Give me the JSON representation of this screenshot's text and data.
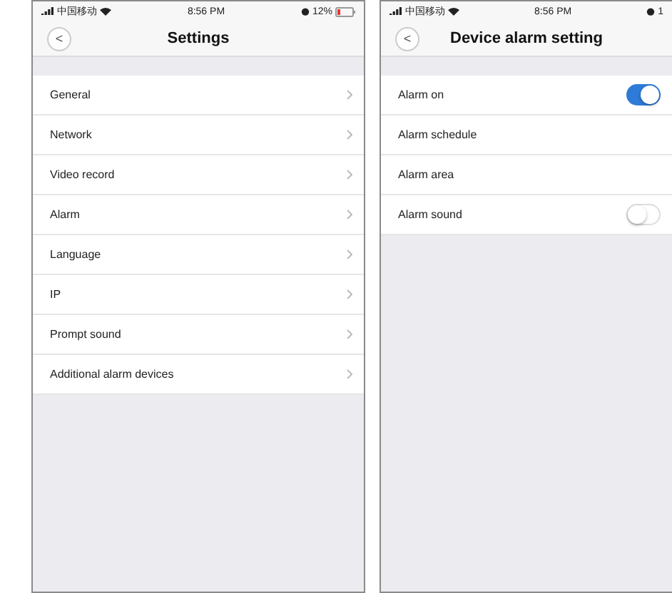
{
  "screens": [
    {
      "status": {
        "carrier": "中国移动",
        "time": "8:56 PM",
        "battery": "12%"
      },
      "title": "Settings",
      "back": "<",
      "rows": [
        {
          "kind": "link",
          "label": "General"
        },
        {
          "kind": "link",
          "label": "Network"
        },
        {
          "kind": "link",
          "label": "Video record"
        },
        {
          "kind": "link",
          "label": "Alarm"
        },
        {
          "kind": "link",
          "label": "Language"
        },
        {
          "kind": "link",
          "label": "IP"
        },
        {
          "kind": "link",
          "label": "Prompt sound"
        },
        {
          "kind": "link",
          "label": "Additional alarm devices"
        }
      ]
    },
    {
      "status": {
        "carrier": "中国移动",
        "time": "8:56 PM",
        "battery": "1"
      },
      "title": "Device alarm setting",
      "back": "<",
      "rows": [
        {
          "kind": "switch",
          "label": "Alarm on",
          "on": true
        },
        {
          "kind": "plain",
          "label": "Alarm schedule"
        },
        {
          "kind": "plain",
          "label": "Alarm area"
        },
        {
          "kind": "switch",
          "label": "Alarm sound",
          "on": false
        }
      ]
    }
  ]
}
